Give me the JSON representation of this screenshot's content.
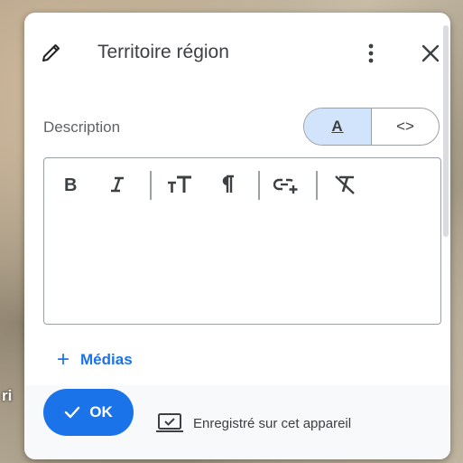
{
  "map": {
    "label": "ri"
  },
  "header": {
    "title": "Territoire région"
  },
  "description": {
    "label": "Description",
    "mode_toggle": {
      "rich_label": "A",
      "code_label": "<>"
    }
  },
  "toolbar": {
    "buttons": [
      "bold-icon",
      "italic-icon",
      "text-size-icon",
      "paragraph-icon",
      "insert-link-icon",
      "clear-format-icon"
    ]
  },
  "media": {
    "label": "Médias",
    "plus": "+"
  },
  "footer": {
    "ok_label": "OK",
    "saved_status": "Enregistré sur cet appareil"
  },
  "colors": {
    "accent": "#1a73e8",
    "toggle_active": "#d2e3fc",
    "text": "#3c4043"
  }
}
